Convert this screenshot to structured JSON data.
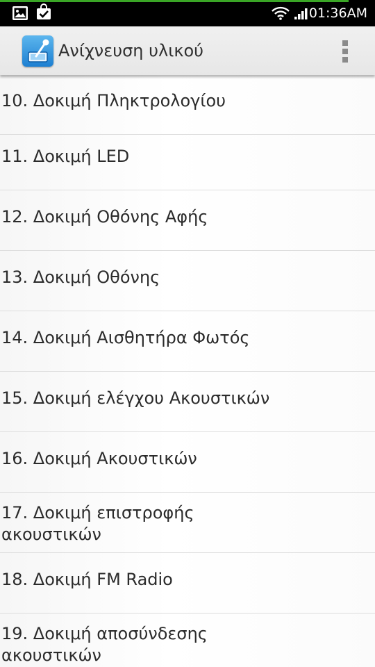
{
  "status_bar": {
    "time": "01:36AM",
    "progress_fraction": 0.93,
    "progress_color": "#3aa626",
    "left_icons": [
      "gallery-icon",
      "play-store-icon"
    ],
    "right_icons": [
      "wifi-icon",
      "signal-icon"
    ]
  },
  "action_bar": {
    "title": "Ανίχνευση υλικού",
    "app_icon": "hardware-test-app-icon",
    "menu_icon": "overflow-menu-icon"
  },
  "list": {
    "items": [
      {
        "label": "10. Δοκιμή Πληκτρολογίου"
      },
      {
        "label": "11. Δοκιμή LED"
      },
      {
        "label": "12. Δοκιμή Οθόνης Αφής"
      },
      {
        "label": "13. Δοκιμή Οθόνης"
      },
      {
        "label": "14. Δοκιμή Αισθητήρα Φωτός"
      },
      {
        "label": "15. Δοκιμή ελέγχου Ακουστικών"
      },
      {
        "label": "16. Δοκιμή Ακουστικών"
      },
      {
        "label": "17. Δοκιμή επιστροφής ακουστικών"
      },
      {
        "label": "18. Δοκιμή FM Radio"
      },
      {
        "label": "19. Δοκιμή αποσύνδεσης ακουστικών"
      }
    ]
  }
}
